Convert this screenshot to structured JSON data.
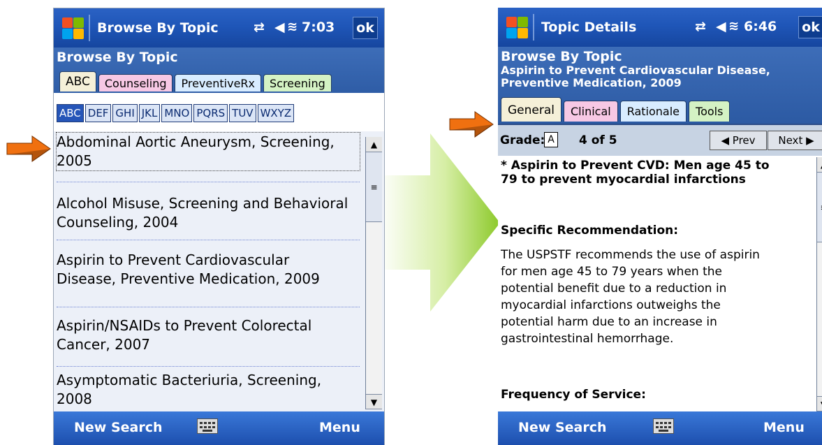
{
  "left": {
    "title": "Browse By Topic",
    "time": "7:03",
    "ok": "ok",
    "header": "Browse By Topic",
    "tabs": [
      "ABC",
      "Counseling",
      "PreventiveRx",
      "Screening"
    ],
    "alpha": [
      "ABC",
      "DEF",
      "GHI",
      "JKL",
      "MNO",
      "PQRS",
      "TUV",
      "WXYZ"
    ],
    "items": [
      [
        "Abdominal Aortic Aneurysm, Screening,",
        "2005"
      ],
      [
        "Alcohol Misuse, Screening and Behavioral",
        "Counseling, 2004"
      ],
      [
        "Aspirin to Prevent Cardiovascular",
        "Disease, Preventive Medication, 2009"
      ],
      [
        "Aspirin/NSAIDs to Prevent Colorectal",
        "Cancer, 2007"
      ],
      [
        "Asymptomatic Bacteriuria, Screening,",
        "2008"
      ]
    ],
    "menu_left": "New Search",
    "menu_right": "Menu"
  },
  "right": {
    "title": "Topic Details",
    "time": "6:46",
    "ok": "ok",
    "header": "Browse By Topic",
    "subheader": [
      "Aspirin to Prevent Cardiovascular Disease,",
      "Preventive Medication, 2009"
    ],
    "tabs": [
      "General",
      "Clinical",
      "Rationale",
      "Tools"
    ],
    "grade_label": "Grade:",
    "grade_value": "A",
    "pager": "4 of 5",
    "prev": "◀ Prev",
    "next": "Next ▶",
    "rec_title": [
      "* Aspirin to Prevent CVD: Men age 45 to",
      "79 to prevent myocardial infarctions"
    ],
    "section1": "Specific Recommendation:",
    "body": [
      "The USPSTF recommends the use of aspirin",
      "for men age 45 to 79 years when the",
      "potential benefit due to a reduction in",
      "myocardial infarctions outweighs the",
      "potential harm due to an increase in",
      "gastrointestinal hemorrhage."
    ],
    "section2": "Frequency of Service:",
    "menu_left": "New Search",
    "menu_right": "Menu"
  },
  "colors": {
    "accent_arrow": "#f07010",
    "transition_arrow": "#9ed23a",
    "tab_abc": "#f5f0d8",
    "tab_counseling": "#f7c8e4",
    "tab_prevrx": "#d8ecff",
    "tab_screening": "#d4f2c4"
  },
  "icons": [
    "windows-logo-icon",
    "connectivity-icon",
    "speaker-icon",
    "keyboard-icon",
    "pointer-arrow-icon"
  ]
}
